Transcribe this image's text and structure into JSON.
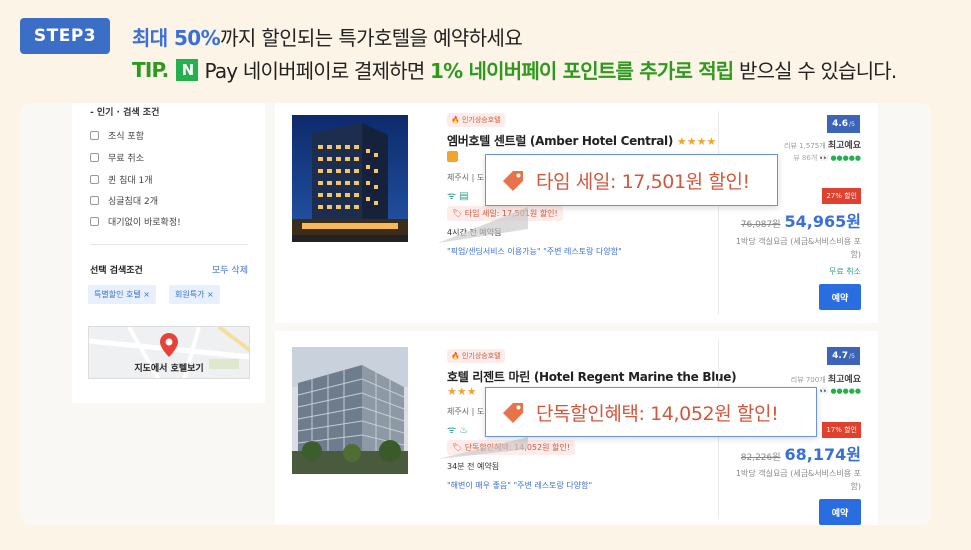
{
  "header": {
    "step_label": "STEP3",
    "headline_highlight": "최대 50%",
    "headline_rest": "까지 할인되는 특가호텔을 예약하세요",
    "tip_label": "TIP.",
    "npay_logo_letter": "N",
    "tip_text": "Pay 네이버페이로 결제하면",
    "tip_highlight": "1% 네이버페이 포인트를 추가로 적립",
    "tip_rest": "받으실 수 있습니다."
  },
  "sidebar": {
    "section_title": "- 인기 · 검색 조건",
    "filters": [
      "조식 포함",
      "무료 취소",
      "퀸 침대 1개",
      "싱글침대 2개",
      "대기없이 바로확정!"
    ],
    "selected_title": "선택 검색조건",
    "clear_all": "모두 삭제",
    "chips": [
      "특별할인 호텔 ×",
      "회원특가 ×"
    ],
    "map_label": "지도에서 호텔보기"
  },
  "hotels": [
    {
      "badge": "인기상승호텔",
      "name": "엠버호텔 센트럴 (Amber Hotel Central)",
      "stars": "★★★★",
      "location": "제주시 | 도",
      "amenities": "ᯤ ▤",
      "discount_label": "타임 세일: 17,501원 할인!",
      "recent_booking": "4시간 전 예약됨",
      "tags": "\"픽업/샌딩서비스 이용가능\" \"주변 레스토랑 다양함\"",
      "score": "4.6",
      "score_max": "/5",
      "review_count": "리뷰 1,575개",
      "review_grade": "최고예요",
      "trip_text": "뷰 86개",
      "trip_dots": "●●●●●",
      "rate_off": "27% 할인",
      "original_price": "76,087원",
      "price": "54,965원",
      "per_night": "1박당 객실요금 (세금&서비스비용 포함)",
      "cancel": "무료 취소",
      "book": "예약",
      "callout": "타임 세일: 17,501원 할인!"
    },
    {
      "badge": "인기상승호텔",
      "name": "호텔 리젠트 마린 (Hotel Regent Marine the Blue)",
      "stars": "★★★",
      "location": "제주시 | 도",
      "amenities": "ᯤ ♨",
      "discount_label": "단독할인혜택: 14,052원 할인!",
      "recent_booking": "34분 전 예약됨",
      "tags": "\"해변이 매우 좋음\" \"주변 레스토랑 다양함\"",
      "score": "4.7",
      "score_max": "/5",
      "review_count": "리뷰 700개",
      "review_grade": "최고예요",
      "trip_dots": "●●●●●",
      "rate_off": "17% 할인",
      "original_price": "82,226원",
      "price": "68,174원",
      "per_night": "1박당 객실요금 (세금&서비스비용 포함)",
      "book": "예약",
      "callout": "단독할인혜택: 14,052원 할인!"
    }
  ],
  "colors": {
    "accent_blue": "#3a6fd6",
    "npay_green": "#22b14c",
    "discount_red": "#d2573b",
    "button_blue": "#2a6de0"
  }
}
